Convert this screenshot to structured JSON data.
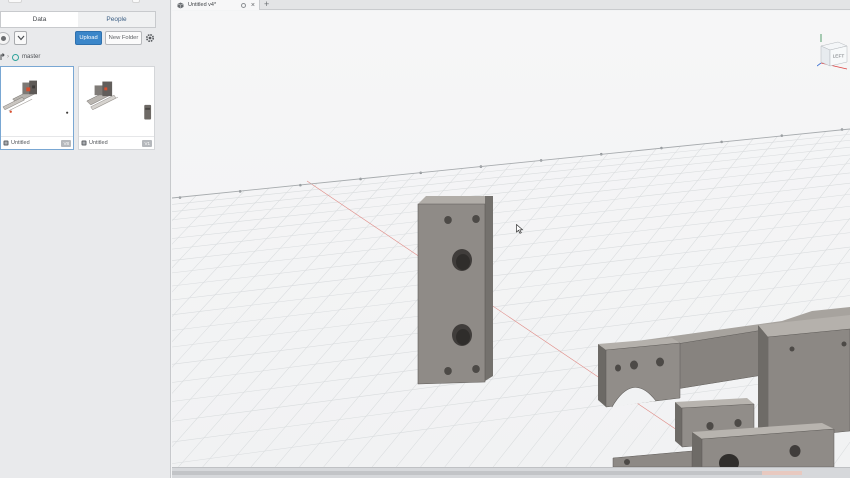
{
  "data_panel": {
    "tabs": [
      {
        "label": "Data",
        "active": true
      },
      {
        "label": "People",
        "active": false
      }
    ],
    "toolbar": {
      "upload_label": "Upload",
      "new_folder_label": "New Folder"
    },
    "breadcrumb": {
      "folder": "master"
    },
    "files": [
      {
        "name": "Untitled",
        "version": "V8",
        "selected": true
      },
      {
        "name": "Untitled",
        "version": "V1",
        "selected": false
      }
    ]
  },
  "document_tab": {
    "title": "Untitled v4*"
  },
  "view_cube": {
    "face_label": "LEFT"
  },
  "colors": {
    "accent_blue": "#3b86c9",
    "part_gray": "#8a8682",
    "grid_line": "#d9dcde",
    "axis_red": "#e26a6a"
  }
}
